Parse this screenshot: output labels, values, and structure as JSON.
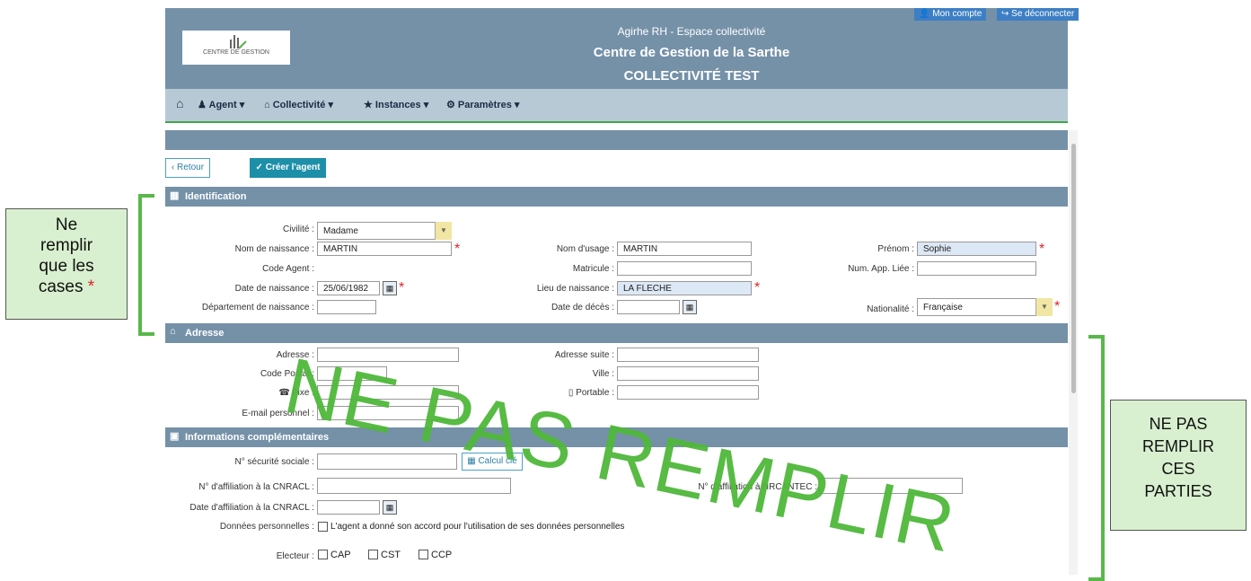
{
  "header": {
    "subtitle": "Agirhe RH - Espace collectivité",
    "organization": "Centre de Gestion de la Sarthe",
    "collectivity": "COLLECTIVITÉ TEST",
    "logo_text": "CENTRE DE GESTION",
    "account_label": "Mon compte",
    "logout_label": "Se déconnecter"
  },
  "nav": {
    "items": [
      "Agent",
      "Collectivité",
      "Instances",
      "Paramètres"
    ]
  },
  "actions": {
    "back": "Retour",
    "create": "Créer l'agent"
  },
  "sections": {
    "identification": "Identification",
    "address": "Adresse",
    "complementary": "Informations complémentaires"
  },
  "identification": {
    "civility_label": "Civilité :",
    "civility_value": "Madame",
    "birth_name_label": "Nom de naissance :",
    "birth_name_value": "MARTIN",
    "usage_name_label": "Nom d'usage :",
    "usage_name_value": "MARTIN",
    "first_name_label": "Prénom :",
    "first_name_value": "Sophie",
    "agent_code_label": "Code Agent :",
    "matricule_label": "Matricule :",
    "app_link_label": "Num. App. Liée :",
    "birth_date_label": "Date de naissance :",
    "birth_date_value": "25/06/1982",
    "birth_place_label": "Lieu de naissance :",
    "birth_place_value": "LA FLECHE",
    "birth_dept_label": "Département de naissance :",
    "death_date_label": "Date de décès :",
    "nationality_label": "Nationalité :",
    "nationality_value": "Française"
  },
  "address": {
    "address_label": "Adresse :",
    "address_more_label": "Adresse suite :",
    "postal_label": "Code Postal :",
    "city_label": "Ville :",
    "fixed_label": "Fixe :",
    "mobile_label": "Portable :",
    "email_label": "E-mail personnel :"
  },
  "complementary": {
    "ssn_label": "N° sécurité sociale :",
    "calc_button": "Calcul clé",
    "cnracl_label": "N° d'affiliation à la CNRACL :",
    "ircantec_label": "N° d'affiliation à l'IRCANTEC :",
    "cnracl_date_label": "Date d'affiliation à la CNRACL :",
    "personal_data_label": "Données personnelles :",
    "personal_data_text": "L'agent a donné son accord pour l'utilisation de ses données personnelles",
    "elector_label": "Electeur :",
    "elector_options": [
      "CAP",
      "CST",
      "CCP"
    ]
  },
  "annotations": {
    "left_note": [
      "Ne",
      "remplir",
      "que les",
      "cases"
    ],
    "left_star": "*",
    "right_note": [
      "NE PAS",
      "REMPLIR",
      "CES",
      "PARTIES"
    ],
    "watermark": "NE PAS REMPLIR"
  },
  "colors": {
    "header": "#7591a8",
    "nav": "#b8c9d6",
    "accent_green": "#4fb83a",
    "required": "#d9242c"
  }
}
